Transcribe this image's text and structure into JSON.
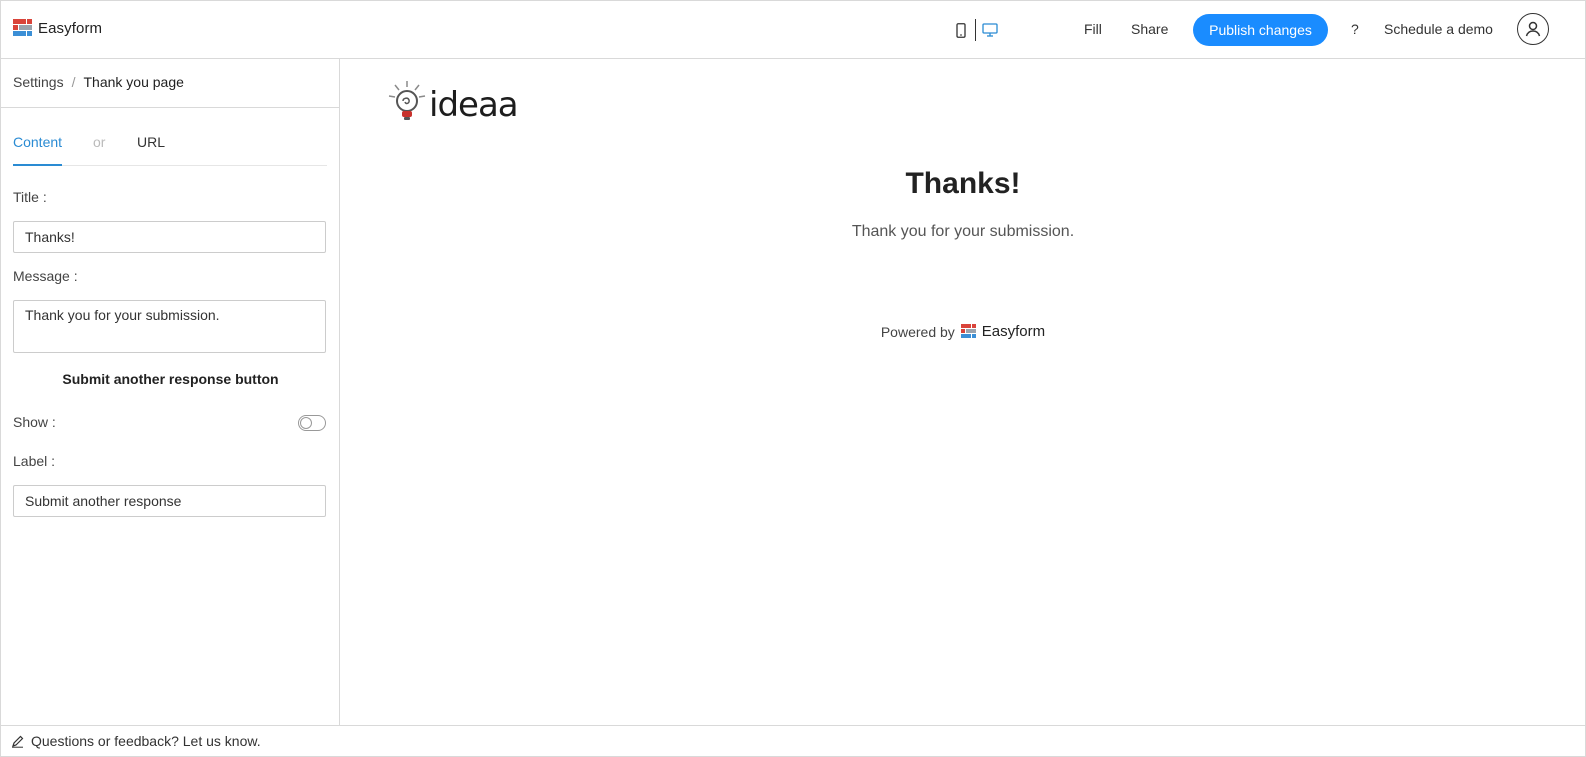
{
  "header": {
    "brand": "Easyform",
    "device_icons": [
      "mobile-icon",
      "desktop-icon"
    ],
    "fill": "Fill",
    "share": "Share",
    "publish": "Publish changes",
    "help": "?",
    "schedule_demo": "Schedule a demo",
    "user_icon": "user-icon"
  },
  "breadcrumb": {
    "settings": "Settings",
    "separator": "/",
    "current": "Thank you page"
  },
  "tabs": {
    "content": "Content",
    "or": "or",
    "url": "URL"
  },
  "form": {
    "title_label": "Title",
    "title_value": "Thanks!",
    "message_label": "Message",
    "message_value": "Thank you for your submission.",
    "submit_section": "Submit another response button",
    "show_label": "Show",
    "show_enabled": false,
    "label_label": "Label",
    "label_value": "Submit another response"
  },
  "preview": {
    "logo_text": "ideaa",
    "title": "Thanks!",
    "message": "Thank you for your submission.",
    "powered_by": "Powered by",
    "powered_brand": "Easyform"
  },
  "footer": {
    "feedback": "Questions or feedback? Let us know.",
    "icon": "pencil-icon"
  },
  "colors": {
    "accent": "#1a8cff",
    "tab_active": "#2a8bd3",
    "logo_red": "#d9443a",
    "logo_blue": "#3b8fd6",
    "logo_gray": "#9aa3ad"
  }
}
